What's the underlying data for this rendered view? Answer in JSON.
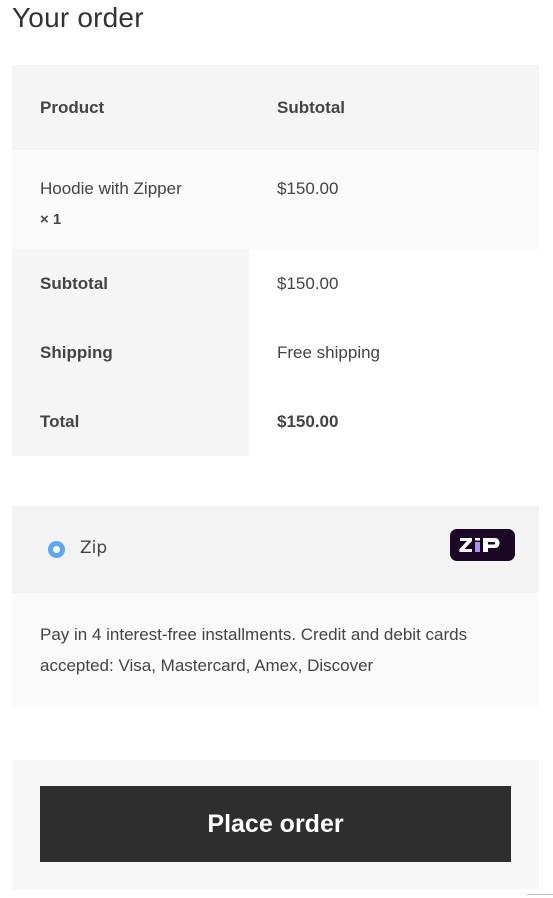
{
  "order": {
    "heading": "Your order",
    "columns": {
      "product": "Product",
      "subtotal": "Subtotal"
    },
    "items": [
      {
        "name": "Hoodie with Zipper",
        "quantity": "× 1",
        "price": "$150.00"
      }
    ],
    "totals": [
      {
        "label": "Subtotal",
        "value": "$150.00"
      },
      {
        "label": "Shipping",
        "value": "Free shipping"
      },
      {
        "label": "Total",
        "value": "$150.00"
      }
    ]
  },
  "payment": {
    "method_label": "Zip",
    "selected": true,
    "description": "Pay in 4 interest-free installments. Credit and debit cards accepted: Visa, Mastercard, Amex, Discover",
    "logo_text": "ZIP",
    "logo_icon": "zip-logo-icon",
    "logo_bg": "#1a0826",
    "logo_accent": "#aa8fff"
  },
  "actions": {
    "place_order_label": "Place order"
  },
  "colors": {
    "radio_selected": "#5aa9f2",
    "button_bg": "#2e2e2e"
  }
}
